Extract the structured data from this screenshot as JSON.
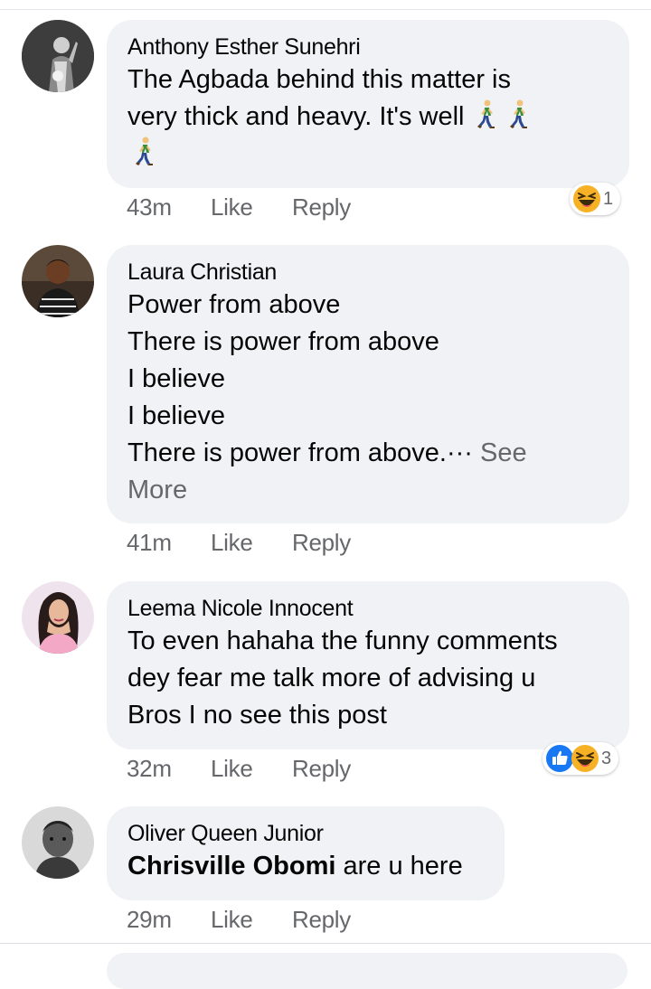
{
  "comments": [
    {
      "author": "Anthony Esther Sunehri",
      "lines": [
        "The Agbada behind this matter is",
        "very thick and heavy. It's well"
      ],
      "emoji": "person-walking-emoji",
      "time": "43m",
      "like": "Like",
      "reply": "Reply",
      "reaction_icons": [
        "haha-reaction-icon"
      ],
      "reaction_count": "1"
    },
    {
      "author": "Laura Christian",
      "lines": [
        "Power from above",
        "There is power from above",
        "I believe",
        "I believe",
        "There is power from above.···"
      ],
      "see_more_a": " See",
      "see_more_b": "More",
      "time": "41m",
      "like": "Like",
      "reply": "Reply"
    },
    {
      "author": "Leema Nicole Innocent",
      "lines": [
        "To even hahaha the funny comments",
        "dey fear me talk more of advising u",
        "Bros I no see this post"
      ],
      "time": "32m",
      "like": "Like",
      "reply": "Reply",
      "reaction_icons": [
        "like-reaction-icon",
        "haha-reaction-icon"
      ],
      "reaction_count": "3"
    },
    {
      "author": "Oliver Queen Junior",
      "mention": "Chrisville Obomi",
      "text_after_mention": " are u here",
      "time": "29m",
      "like": "Like",
      "reply": "Reply"
    }
  ],
  "colors": {
    "bubble": "#f0f2f5",
    "secondary_text": "#65676b",
    "like_blue": "#1877f2",
    "haha_yellow": "#f7b125"
  }
}
